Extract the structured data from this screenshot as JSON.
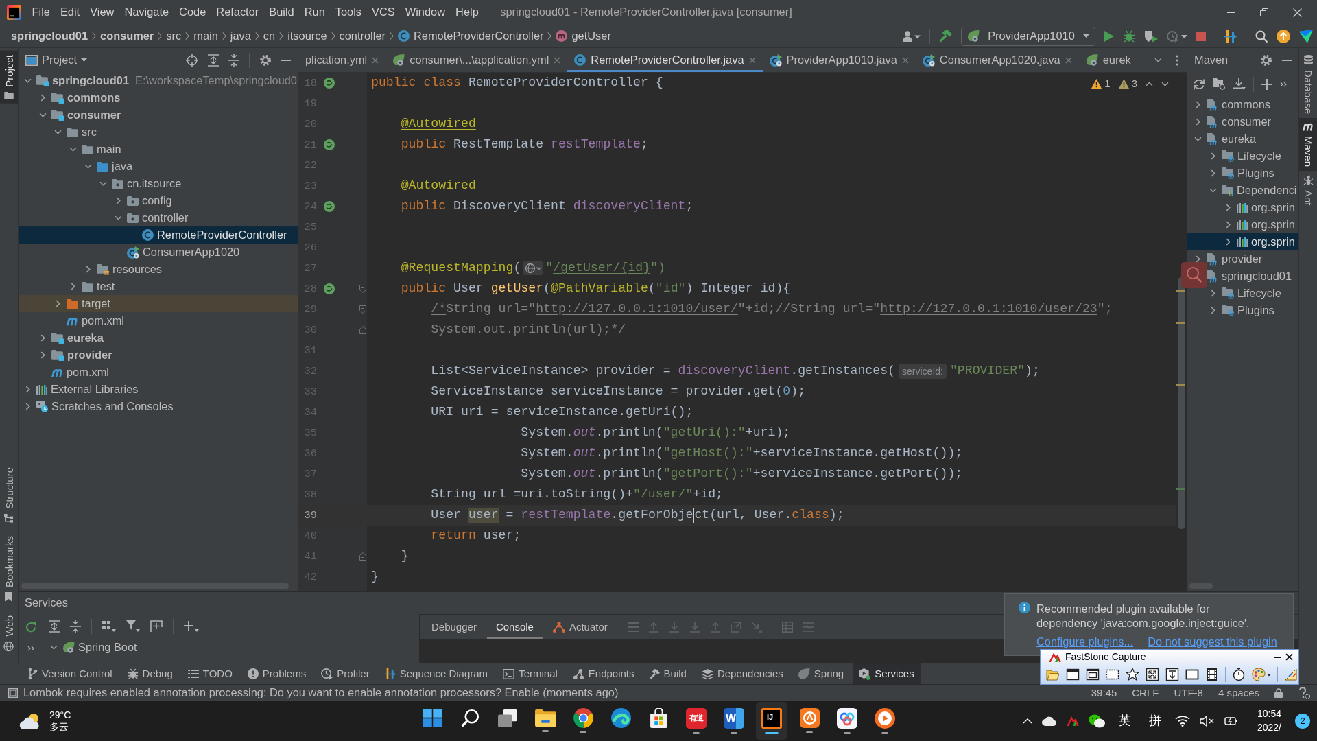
{
  "window": {
    "title": "springcloud01 - RemoteProviderController.java [consumer]"
  },
  "menu": [
    "File",
    "Edit",
    "View",
    "Navigate",
    "Code",
    "Refactor",
    "Build",
    "Run",
    "Tools",
    "VCS",
    "Window",
    "Help"
  ],
  "breadcrumbs": [
    {
      "label": "springcloud01",
      "kind": "module"
    },
    {
      "label": "consumer",
      "kind": "module"
    },
    {
      "label": "src",
      "kind": "folder"
    },
    {
      "label": "main",
      "kind": "folder"
    },
    {
      "label": "java",
      "kind": "folder"
    },
    {
      "label": "cn",
      "kind": "folder"
    },
    {
      "label": "itsource",
      "kind": "folder"
    },
    {
      "label": "controller",
      "kind": "folder"
    },
    {
      "label": "RemoteProviderController",
      "kind": "class"
    },
    {
      "label": "getUser",
      "kind": "method"
    }
  ],
  "toolbar": {
    "run_configuration": "ProviderApp1010"
  },
  "left_stripe": {
    "top": [
      {
        "label": "Project",
        "kind": "project",
        "selected": true
      }
    ],
    "bottom": [
      {
        "label": "Structure",
        "kind": "structure",
        "selected": false
      },
      {
        "label": "Bookmarks",
        "kind": "bookmarks",
        "selected": false
      },
      {
        "label": "Web",
        "kind": "web",
        "selected": false
      }
    ]
  },
  "project_panel": {
    "title": "Project",
    "tree": [
      {
        "label": "springcloud01",
        "kind": "module",
        "path": "E:\\workspaceTemp\\springcloud0",
        "expanded": true,
        "selected": false,
        "children": [
          {
            "label": "commons",
            "kind": "module",
            "expanded": false,
            "selected": false
          },
          {
            "label": "consumer",
            "kind": "module",
            "expanded": true,
            "selected": false,
            "children": [
              {
                "label": "src",
                "kind": "folder",
                "expanded": true,
                "selected": false,
                "children": [
                  {
                    "label": "main",
                    "kind": "folder",
                    "expanded": true,
                    "selected": false,
                    "children": [
                      {
                        "label": "java",
                        "kind": "source_root",
                        "expanded": true,
                        "selected": false,
                        "children": [
                          {
                            "label": "cn.itsource",
                            "kind": "package",
                            "expanded": true,
                            "selected": false,
                            "children": [
                              {
                                "label": "config",
                                "kind": "package",
                                "expanded": false,
                                "selected": false
                              },
                              {
                                "label": "controller",
                                "kind": "package",
                                "expanded": true,
                                "selected": false,
                                "children": [
                                  {
                                    "label": "RemoteProviderController",
                                    "kind": "class",
                                    "selected": true
                                  }
                                ]
                              },
                              {
                                "label": "ConsumerApp1020",
                                "kind": "spring_app",
                                "selected": false
                              }
                            ]
                          }
                        ]
                      },
                      {
                        "label": "resources",
                        "kind": "resources_root",
                        "expanded": false,
                        "selected": false
                      }
                    ]
                  },
                  {
                    "label": "test",
                    "kind": "folder",
                    "expanded": false,
                    "selected": false
                  }
                ]
              },
              {
                "label": "target",
                "kind": "excluded",
                "expanded": false,
                "selected": false
              },
              {
                "label": "pom.xml",
                "kind": "maven_file",
                "selected": false
              }
            ]
          },
          {
            "label": "eureka",
            "kind": "module",
            "expanded": false,
            "selected": false
          },
          {
            "label": "provider",
            "kind": "module",
            "expanded": false,
            "selected": false
          },
          {
            "label": "pom.xml",
            "kind": "maven_file",
            "selected": false
          }
        ]
      },
      {
        "label": "External Libraries",
        "kind": "libraries",
        "expanded": false,
        "selected": false
      },
      {
        "label": "Scratches and Consoles",
        "kind": "scratches",
        "expanded": false,
        "selected": false
      }
    ]
  },
  "editor": {
    "tabs": [
      {
        "label": "plication.yml",
        "kind": "plain",
        "selected": false,
        "closable": true
      },
      {
        "label": "consumer\\...\\application.yml",
        "kind": "spring_config",
        "selected": false,
        "closable": true
      },
      {
        "label": "RemoteProviderController.java",
        "kind": "class",
        "selected": true,
        "closable": true
      },
      {
        "label": "ProviderApp1010.java",
        "kind": "spring_app",
        "selected": false,
        "closable": true
      },
      {
        "label": "ConsumerApp1020.java",
        "kind": "spring_app",
        "selected": false,
        "closable": true
      },
      {
        "label": "eurek",
        "kind": "spring_config",
        "selected": false,
        "closable": false
      }
    ],
    "inspections": {
      "warnings": "1",
      "weak_warnings": "3"
    },
    "lines": [
      {
        "number": "18",
        "gutter_marker": true,
        "tokens": [
          {
            "text": "public class",
            "kind": "keyword"
          },
          {
            "text": " RemoteProviderController {",
            "kind": "plain"
          }
        ]
      },
      {
        "number": "19"
      },
      {
        "number": "20",
        "tokens": [
          {
            "text": "    @Autowired",
            "kind": "annotation",
            "underline": true
          }
        ]
      },
      {
        "number": "21",
        "gutter_marker": true,
        "tokens": [
          {
            "text": "    public",
            "kind": "keyword"
          },
          {
            "text": " RestTemplate ",
            "kind": "plain"
          },
          {
            "text": "restTemplate",
            "kind": "field"
          },
          {
            "text": ";",
            "kind": "plain"
          }
        ]
      },
      {
        "number": "22"
      },
      {
        "number": "23",
        "tokens": [
          {
            "text": "    @Autowired",
            "kind": "annotation",
            "underline": true
          }
        ]
      },
      {
        "number": "24",
        "gutter_marker": true,
        "tokens": [
          {
            "text": "    public",
            "kind": "keyword"
          },
          {
            "text": " DiscoveryClient ",
            "kind": "plain"
          },
          {
            "text": "discoveryClient",
            "kind": "field"
          },
          {
            "text": ";",
            "kind": "plain"
          }
        ]
      },
      {
        "number": "25"
      },
      {
        "number": "26"
      },
      {
        "number": "27",
        "tokens": [
          {
            "text": "    @RequestMapping",
            "kind": "annotation"
          },
          {
            "text": "(",
            "kind": "plain"
          },
          {
            "kind": "endpoint_icon"
          },
          {
            "text": "\"",
            "kind": "string"
          },
          {
            "text": "/getUser/{id}",
            "kind": "string",
            "underline": true
          },
          {
            "text": "\")",
            "kind": "string"
          }
        ]
      },
      {
        "number": "28",
        "gutter_marker": true,
        "fold_start": true,
        "tokens": [
          {
            "text": "    public",
            "kind": "keyword"
          },
          {
            "text": " User ",
            "kind": "plain"
          },
          {
            "text": "getUser",
            "kind": "method_decl"
          },
          {
            "text": "(",
            "kind": "plain"
          },
          {
            "text": "@PathVariable",
            "kind": "annotation"
          },
          {
            "text": "(",
            "kind": "plain"
          },
          {
            "text": "\"",
            "kind": "string"
          },
          {
            "text": "id",
            "kind": "string",
            "underline": true
          },
          {
            "text": "\"",
            "kind": "string"
          },
          {
            "text": ") Integer id){",
            "kind": "plain"
          }
        ]
      },
      {
        "number": "29",
        "fold_start": true,
        "tokens": [
          {
            "text": "        /*",
            "kind": "comment",
            "underline": true
          },
          {
            "text": "String url=\"",
            "kind": "comment"
          },
          {
            "text": "http://127.0.0.1:1010/user/",
            "kind": "comment",
            "underline": true
          },
          {
            "text": "\"+id;//String url=\"",
            "kind": "comment"
          },
          {
            "text": "http://127.0.0.1:1010/user/23",
            "kind": "comment",
            "underline": true
          },
          {
            "text": "\";",
            "kind": "comment"
          }
        ]
      },
      {
        "number": "30",
        "fold_end": true,
        "tokens": [
          {
            "text": "        System.out.println(url);*/",
            "kind": "comment"
          }
        ]
      },
      {
        "number": "31"
      },
      {
        "number": "32",
        "tokens": [
          {
            "text": "        List<ServiceInstance> provider = ",
            "kind": "plain"
          },
          {
            "text": "discoveryClient",
            "kind": "field"
          },
          {
            "text": ".getInstances(",
            "kind": "plain"
          },
          {
            "text": "serviceId:",
            "kind": "hint"
          },
          {
            "text": "\"PROVIDER\"",
            "kind": "string"
          },
          {
            "text": ");",
            "kind": "plain"
          }
        ]
      },
      {
        "number": "33",
        "tokens": [
          {
            "text": "        ServiceInstance serviceInstance = provider.get(",
            "kind": "plain"
          },
          {
            "text": "0",
            "kind": "number"
          },
          {
            "text": ");",
            "kind": "plain"
          }
        ]
      },
      {
        "number": "34",
        "tokens": [
          {
            "text": "        URI uri = serviceInstance.getUri();",
            "kind": "plain"
          }
        ]
      },
      {
        "number": "35",
        "tokens": [
          {
            "text": "                    System.",
            "kind": "plain"
          },
          {
            "text": "out",
            "kind": "static_field"
          },
          {
            "text": ".println(",
            "kind": "plain"
          },
          {
            "text": "\"getUri():\"",
            "kind": "string"
          },
          {
            "text": "+uri);",
            "kind": "plain"
          }
        ]
      },
      {
        "number": "36",
        "tokens": [
          {
            "text": "                    System.",
            "kind": "plain"
          },
          {
            "text": "out",
            "kind": "static_field"
          },
          {
            "text": ".println(",
            "kind": "plain"
          },
          {
            "text": "\"getHost():\"",
            "kind": "string"
          },
          {
            "text": "+serviceInstance.getHost());",
            "kind": "plain"
          }
        ]
      },
      {
        "number": "37",
        "tokens": [
          {
            "text": "                    System.",
            "kind": "plain"
          },
          {
            "text": "out",
            "kind": "static_field"
          },
          {
            "text": ".println(",
            "kind": "plain"
          },
          {
            "text": "\"getPort():\"",
            "kind": "string"
          },
          {
            "text": "+serviceInstance.getPort());",
            "kind": "plain"
          }
        ]
      },
      {
        "number": "38",
        "tokens": [
          {
            "text": "        String url =uri.toString()+",
            "kind": "plain"
          },
          {
            "text": "\"/user/\"",
            "kind": "string"
          },
          {
            "text": "+id;",
            "kind": "plain"
          }
        ]
      },
      {
        "number": "39",
        "current": true,
        "tokens": [
          {
            "text": "        User ",
            "kind": "plain"
          },
          {
            "text": "user",
            "kind": "plain",
            "highlighted": true
          },
          {
            "text": " = ",
            "kind": "plain"
          },
          {
            "text": "restTemplate",
            "kind": "field"
          },
          {
            "text": ".getForObje",
            "kind": "plain"
          },
          {
            "kind": "caret"
          },
          {
            "text": "ct(url, User.",
            "kind": "plain"
          },
          {
            "text": "class",
            "kind": "keyword"
          },
          {
            "text": ");",
            "kind": "plain"
          }
        ]
      },
      {
        "number": "40",
        "tokens": [
          {
            "text": "        return",
            "kind": "keyword"
          },
          {
            "text": " user;",
            "kind": "plain"
          }
        ]
      },
      {
        "number": "41",
        "fold_end": true,
        "tokens": [
          {
            "text": "    }",
            "kind": "plain"
          }
        ]
      },
      {
        "number": "42",
        "tokens": [
          {
            "text": "}",
            "kind": "plain"
          }
        ]
      }
    ]
  },
  "maven_panel": {
    "title": "Maven",
    "tree": [
      {
        "label": "commons",
        "kind": "maven_module",
        "expanded": false,
        "selected": false
      },
      {
        "label": "consumer",
        "kind": "maven_module",
        "expanded": false,
        "selected": false
      },
      {
        "label": "eureka",
        "kind": "maven_module",
        "expanded": true,
        "selected": false,
        "children": [
          {
            "label": "Lifecycle",
            "kind": "goal_folder",
            "expanded": false,
            "selected": false
          },
          {
            "label": "Plugins",
            "kind": "goal_folder",
            "expanded": false,
            "selected": false
          },
          {
            "label": "Dependenci",
            "kind": "dependencies",
            "expanded": true,
            "selected": false,
            "children": [
              {
                "label": "org.sprin",
                "kind": "dependency",
                "expanded": false,
                "selected": false
              },
              {
                "label": "org.sprin",
                "kind": "dependency",
                "expanded": false,
                "selected": false
              },
              {
                "label": "org.sprin",
                "kind": "dependency",
                "expanded": false,
                "selected": true
              }
            ]
          }
        ]
      },
      {
        "label": "provider",
        "kind": "maven_module",
        "expanded": false,
        "selected": false
      },
      {
        "label": "springcloud01",
        "kind": "maven_module",
        "expanded": true,
        "selected": false,
        "children": [
          {
            "label": "Lifecycle",
            "kind": "goal_folder",
            "expanded": false,
            "selected": false
          },
          {
            "label": "Plugins",
            "kind": "goal_folder",
            "expanded": false,
            "selected": false
          }
        ]
      }
    ]
  },
  "right_stripe": [
    {
      "label": "Database",
      "kind": "database",
      "selected": false
    },
    {
      "label": "Maven",
      "kind": "maven",
      "selected": true
    },
    {
      "label": "Ant",
      "kind": "ant",
      "selected": false
    }
  ],
  "services": {
    "title": "Services",
    "tree": [
      {
        "label": "Spring Boot",
        "kind": "spring_boot",
        "expanded": true,
        "selected": false
      }
    ],
    "tabs": [
      {
        "label": "Debugger",
        "kind": "plain",
        "selected": false
      },
      {
        "label": "Console",
        "kind": "plain",
        "selected": true
      },
      {
        "label": "Actuator",
        "kind": "actuator",
        "selected": false
      }
    ]
  },
  "notification": {
    "text": "Recommended plugin available for dependency 'java:com.google.inject:guice'.",
    "links": [
      "Configure plugins...",
      "Do not suggest this plugin"
    ]
  },
  "tool_windows": [
    {
      "label": "Version Control",
      "kind": "vcs",
      "selected": false
    },
    {
      "label": "Debug",
      "kind": "debug",
      "selected": false
    },
    {
      "label": "TODO",
      "kind": "todo",
      "selected": false
    },
    {
      "label": "Problems",
      "kind": "problems",
      "selected": false
    },
    {
      "label": "Profiler",
      "kind": "profiler",
      "selected": false
    },
    {
      "label": "Sequence Diagram",
      "kind": "sequence",
      "selected": false
    },
    {
      "label": "Terminal",
      "kind": "terminal",
      "selected": false
    },
    {
      "label": "Endpoints",
      "kind": "endpoints",
      "selected": false
    },
    {
      "label": "Build",
      "kind": "build",
      "selected": false
    },
    {
      "label": "Dependencies",
      "kind": "dependencies",
      "selected": false
    },
    {
      "label": "Spring",
      "kind": "spring",
      "selected": false
    },
    {
      "label": "Services",
      "kind": "services",
      "selected": true
    }
  ],
  "status_bar": {
    "message": "Lombok requires enabled annotation processing: Do you want to enable annotation processors? Enable (moments ago)",
    "items": [
      "39:45",
      "CRLF",
      "UTF-8",
      "4 spaces"
    ]
  },
  "capture_window": {
    "title": "FastStone Capture"
  },
  "taskbar": {
    "weather": {
      "temperature": "29°C",
      "condition": "多云"
    },
    "apps": [
      {
        "kind": "start",
        "running": false,
        "selected": false
      },
      {
        "kind": "search",
        "running": false,
        "selected": false
      },
      {
        "kind": "task_view",
        "running": false,
        "selected": false
      },
      {
        "kind": "folder",
        "running": true,
        "selected": false
      },
      {
        "kind": "browser",
        "running": true,
        "selected": false
      },
      {
        "kind": "browser_wave",
        "running": false,
        "selected": false
      },
      {
        "kind": "store",
        "running": false,
        "selected": false
      },
      {
        "kind": "dictionary",
        "label": "有道",
        "running": true,
        "selected": false
      },
      {
        "kind": "document",
        "label": "W",
        "running": true,
        "selected": false
      },
      {
        "kind": "ide",
        "label": "IJ",
        "running": true,
        "selected": true
      },
      {
        "kind": "orange_app",
        "running": true,
        "selected": false
      },
      {
        "kind": "cloud_drive",
        "running": true,
        "selected": false
      },
      {
        "kind": "player",
        "running": true,
        "selected": false
      }
    ],
    "tray": [
      {
        "kind": "chevron"
      },
      {
        "kind": "cloud"
      },
      {
        "kind": "capture"
      },
      {
        "kind": "chat"
      },
      {
        "kind": "text",
        "label": "英"
      },
      {
        "kind": "text",
        "label": "拼"
      },
      {
        "kind": "wifi"
      },
      {
        "kind": "muted_speaker"
      },
      {
        "kind": "power"
      }
    ],
    "time": "10:54",
    "date": "2022/",
    "badge": "2"
  }
}
